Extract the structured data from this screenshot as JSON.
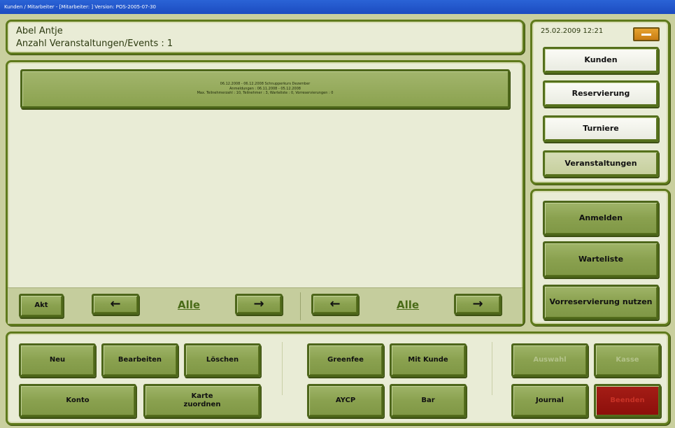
{
  "window": {
    "title": "Kunden / Mitarbeiter - [Mitarbeiter: ] Version: POS-2005-07-30"
  },
  "info": {
    "name": "Abel Antje",
    "event_count": "Anzahl Veranstaltungen/Events : 1"
  },
  "events": [
    {
      "line1": "06.12.2008 - 06.12.2008 Schnupperkurs Dezember",
      "line2": "Anmeldungen : 06.11.2008 - 05.12.2008",
      "line3": "Max. Teilnehmerzahl : 10, Teilnehmer : 3, Warteliste : 0, Vorreservierungen : 0"
    }
  ],
  "nav": {
    "akt_label": "Akt",
    "prev_icon": "arrow-left-icon",
    "next_icon": "arrow-right-icon",
    "alle_left": "Alle",
    "alle_right": "Alle"
  },
  "header_right": {
    "datetime": "25.02.2009 12:21",
    "minimize_icon": "minimize-icon"
  },
  "category_buttons": [
    {
      "label": "Kunden",
      "state": "normal"
    },
    {
      "label": "Reservierung",
      "state": "normal"
    },
    {
      "label": "Turniere",
      "state": "normal"
    },
    {
      "label": "Veranstaltungen",
      "state": "selected"
    }
  ],
  "action_buttons": {
    "anmelden": "Anmelden",
    "warteliste": "Warteliste",
    "vorreservierung": "Vorreservierung nutzen"
  },
  "bottom_buttons": {
    "neu": "Neu",
    "bearbeiten": "Bearbeiten",
    "loeschen": "Löschen",
    "greenfee": "Greenfee",
    "mit_kunde": "Mit Kunde",
    "auswahl": "Auswahl",
    "kasse": "Kasse",
    "konto": "Konto",
    "karte_zuordnen": "Karte\nzuordnen",
    "aycp": "AYCP",
    "bar": "Bar",
    "journal": "Journal",
    "beenden": "Beenden"
  },
  "colors": {
    "panel_border": "#5f7a1c",
    "button_green": "#8aa14f",
    "selected_tab": "#cbd3a4",
    "exit_red": "#8c0f0b",
    "accent_orange": "#d98a1c",
    "titlebar_blue": "#1c4bc0"
  }
}
